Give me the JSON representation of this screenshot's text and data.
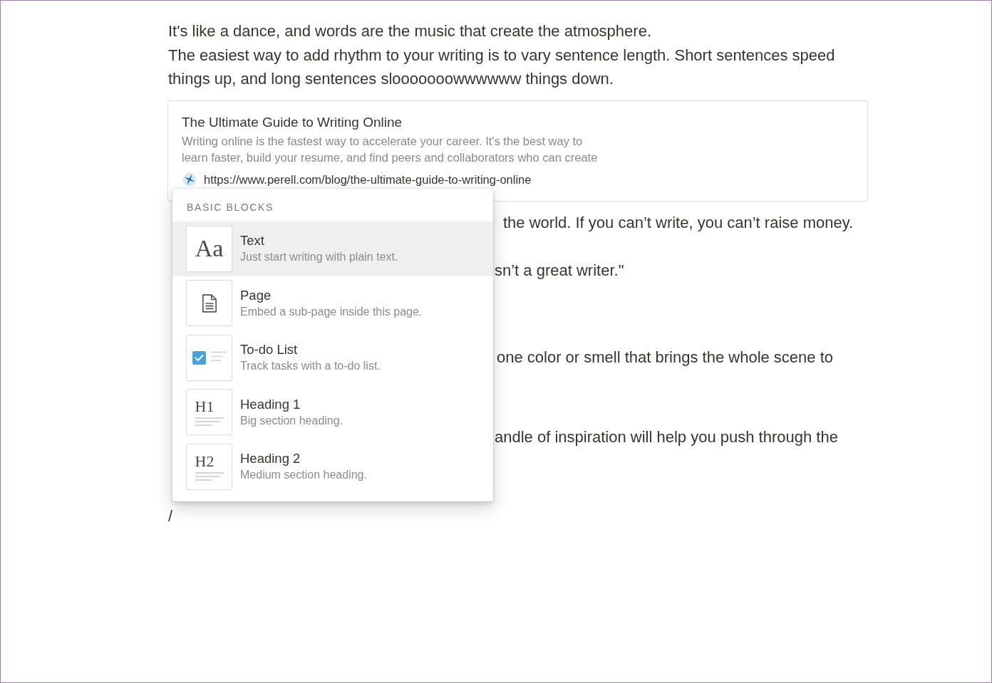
{
  "document": {
    "paragraphs": [
      "It's like a dance, and words are the music that create the atmosphere.",
      "The easiest way to add rhythm to your writing is to vary sentence length. Short sentences speed things up, and long sentences slooooooowwwwww things down."
    ],
    "bookmark": {
      "title": "The Ultimate Guide to Writing Online",
      "description": "Writing online is the fastest way to accelerate your career. It's the best way to learn faster, build your resume, and find peers and collaborators who can create",
      "url": "https://www.perell.com/blog/the-ultimate-guide-to-writing-online"
    },
    "covered_line_fragments": [
      "the world. If you can’t write, you can’t raise money.",
      "sn’t a great writer.\"",
      "one color or smell that brings the whole scene to",
      "andle of inspiration will help you push through the"
    ],
    "typed_text": "/"
  },
  "block_menu": {
    "section_header": "BASIC BLOCKS",
    "items": [
      {
        "kind": "text",
        "tile_label": "Aa",
        "title": "Text",
        "description": "Just start writing with plain text.",
        "selected": true
      },
      {
        "kind": "page",
        "title": "Page",
        "description": "Embed a sub-page inside this page.",
        "selected": false
      },
      {
        "kind": "todo",
        "title": "To-do List",
        "description": "Track tasks with a to-do list.",
        "selected": false
      },
      {
        "kind": "heading",
        "tile_label": "H1",
        "title": "Heading 1",
        "description": "Big section heading.",
        "selected": false
      },
      {
        "kind": "heading",
        "tile_label": "H2",
        "title": "Heading 2",
        "description": "Medium section heading.",
        "selected": false
      }
    ]
  }
}
